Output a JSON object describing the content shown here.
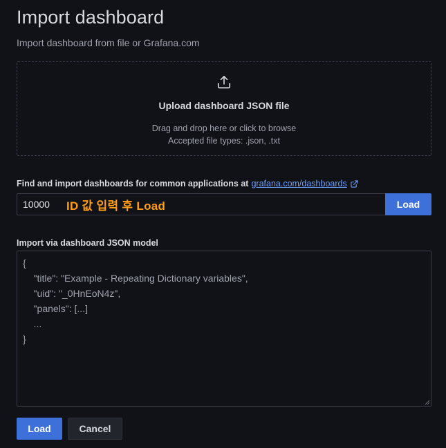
{
  "header": {
    "title": "Import dashboard",
    "subtitle": "Import dashboard from file or Grafana.com"
  },
  "upload": {
    "icon": "upload-icon",
    "title": "Upload dashboard JSON file",
    "hint_line1": "Drag and drop here or click to browse",
    "hint_line2": "Accepted file types: .json, .txt"
  },
  "grafana_import": {
    "label": "Find and import dashboards for common applications at",
    "link_text": "grafana.com/dashboards",
    "link_icon": "external-link-icon",
    "input_value": "10000",
    "annotation": "ID 값 입력 후 Load",
    "load_label": "Load"
  },
  "json_import": {
    "label": "Import via dashboard JSON model",
    "placeholder": "{\n    \"title\": \"Example - Repeating Dictionary variables\",\n    \"uid\": \"_0HnEoN4z\",\n    \"panels\": [...]\n    ...\n}"
  },
  "actions": {
    "load_label": "Load",
    "cancel_label": "Cancel"
  },
  "colors": {
    "background": "#111217",
    "primary": "#3d71d9",
    "link": "#6e9fff",
    "annotation": "#ff9e16"
  }
}
